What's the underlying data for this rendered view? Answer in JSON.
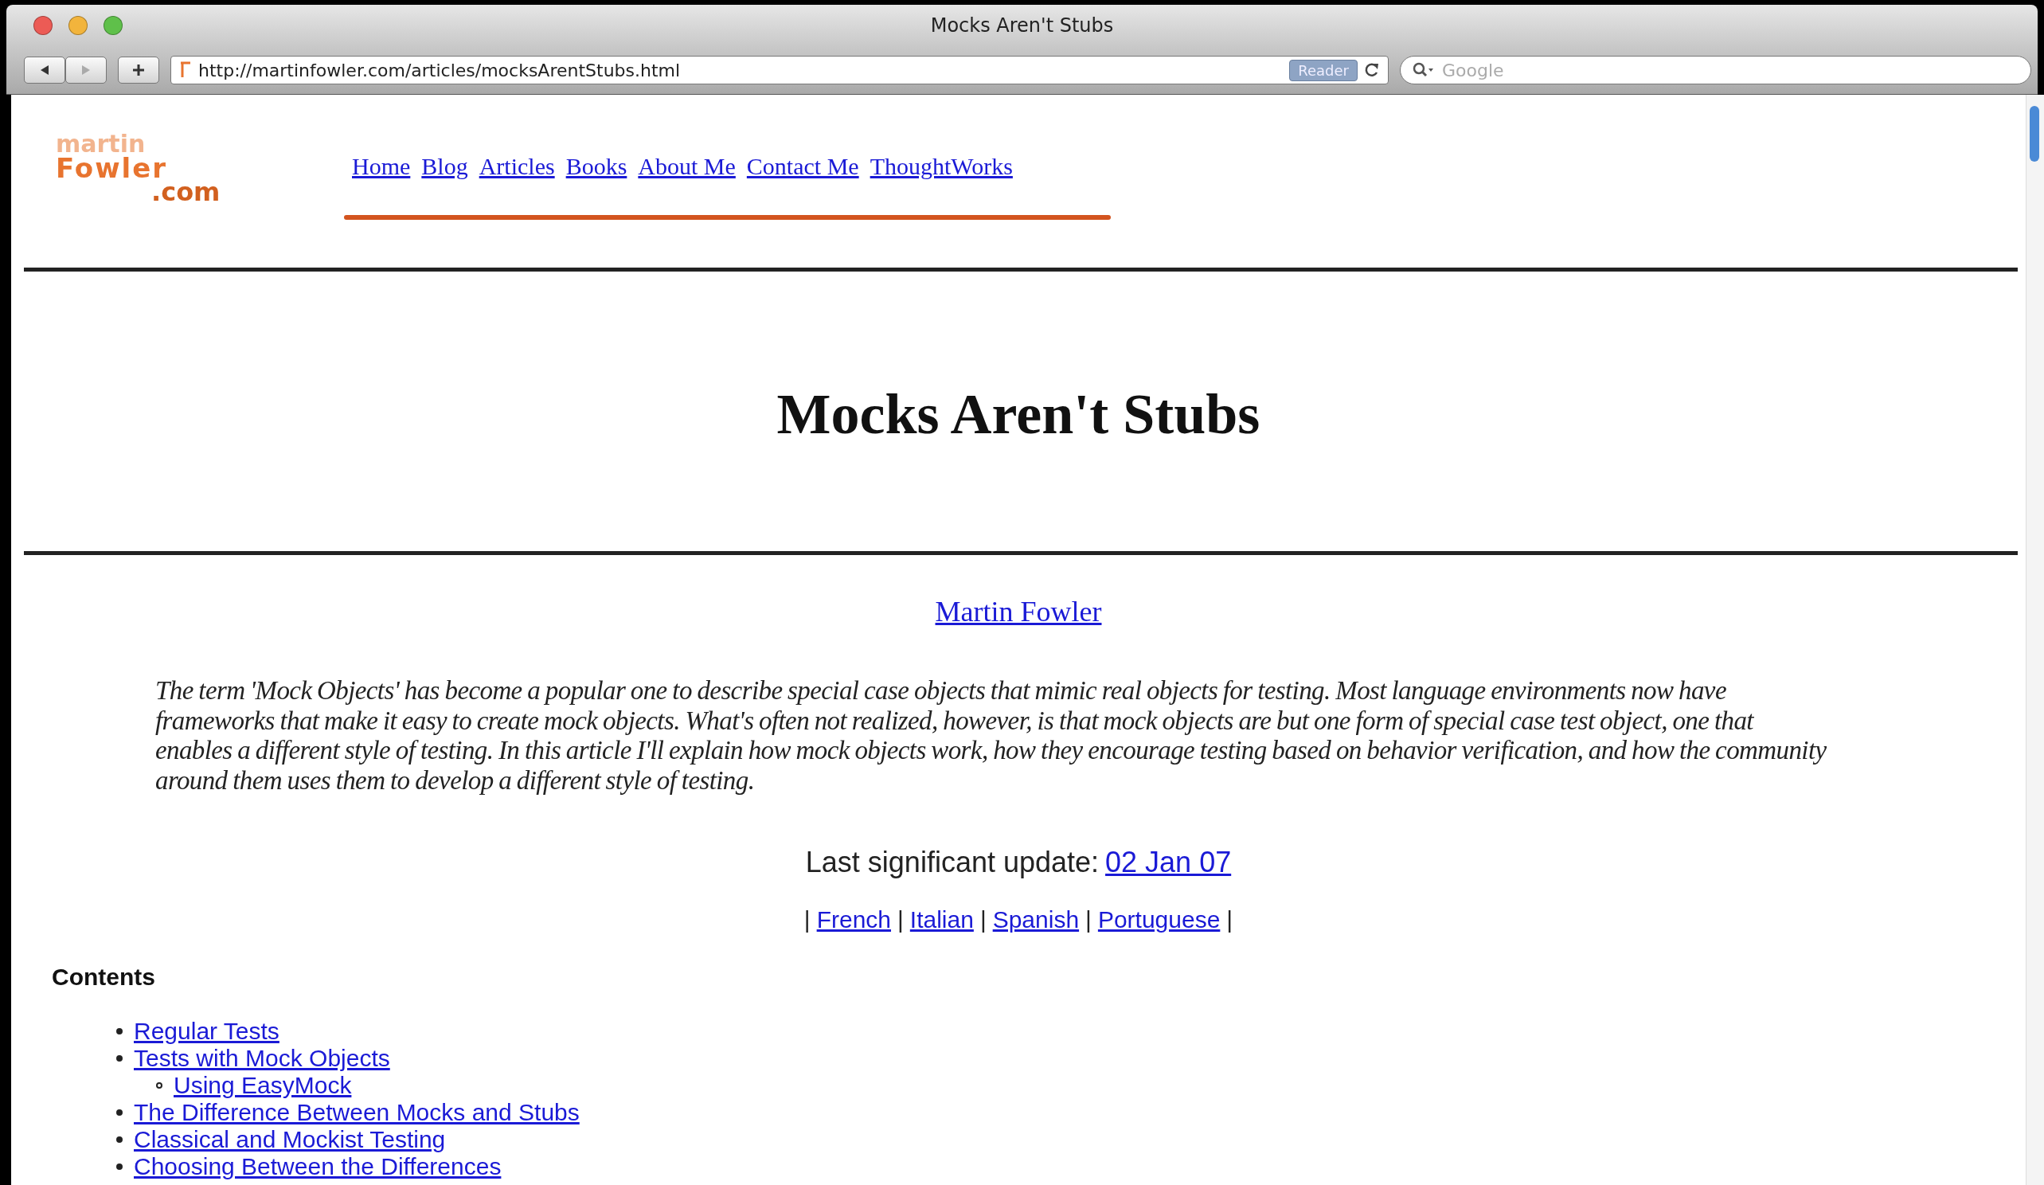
{
  "window": {
    "title": "Mocks Aren't Stubs"
  },
  "toolbar": {
    "url": "http://martinfowler.com/articles/mocksArentStubs.html",
    "reader_button": "Reader",
    "search": {
      "placeholder": "Google"
    }
  },
  "site_logo": {
    "line_1": "martin",
    "line_2": "Fowler",
    "line_3": ".com"
  },
  "nav": [
    {
      "label": "Home"
    },
    {
      "label": "Blog"
    },
    {
      "label": "Articles"
    },
    {
      "label": "Books"
    },
    {
      "label": "About Me"
    },
    {
      "label": "Contact Me"
    },
    {
      "label": "ThoughtWorks"
    }
  ],
  "article": {
    "title": "Mocks Aren't Stubs",
    "author": "Martin Fowler",
    "abstract": "The term 'Mock Objects' has become a popular one to describe special case objects that mimic real objects for testing. Most language environments now have frameworks that make it easy to create mock objects. What's often not realized, however, is that mock objects are but one form of special case test object, one that enables a different style of testing. In this article I'll explain how mock objects work, how they encourage testing based on behavior verification, and how the community around them uses them to develop a different style of testing.",
    "update_label": "Last significant update:",
    "update_date": "02 Jan 07",
    "translations": {
      "separators": [
        "|",
        "|",
        "|",
        "|",
        "|"
      ],
      "items": [
        "French",
        "Italian",
        "Spanish",
        "Portuguese"
      ]
    }
  },
  "contents": {
    "heading": "Contents",
    "items": [
      {
        "label": "Regular Tests"
      },
      {
        "label": "Tests with Mock Objects",
        "children": [
          {
            "label": "Using EasyMock"
          }
        ]
      },
      {
        "label": "The Difference Between Mocks and Stubs"
      },
      {
        "label": "Classical and Mockist Testing"
      },
      {
        "label": "Choosing Between the Differences"
      }
    ]
  }
}
